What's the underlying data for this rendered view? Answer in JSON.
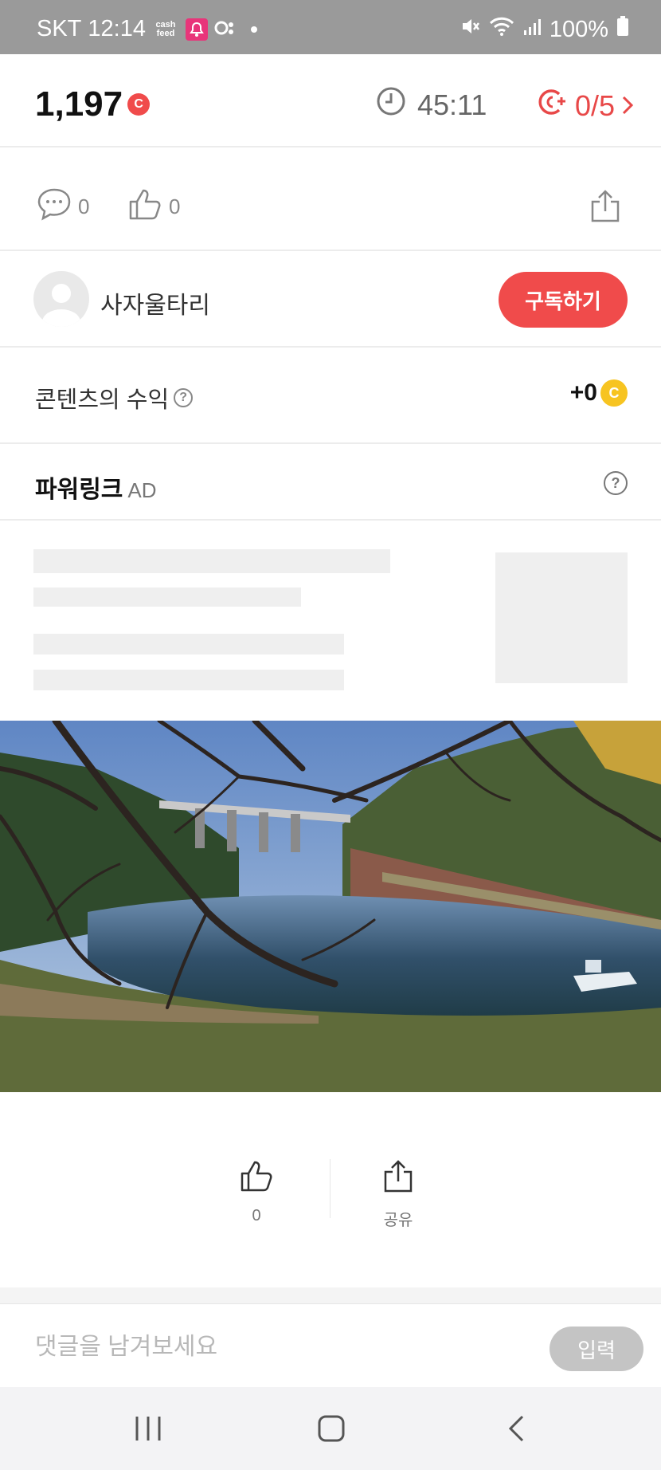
{
  "status_bar": {
    "carrier": "SKT",
    "time": "12:14",
    "cashfeed_line1": "cash",
    "cashfeed_line2": "feed",
    "battery": "100%"
  },
  "header": {
    "points": "1,197",
    "points_coin_letter": "C",
    "timer": "45:11",
    "quota": "0/5"
  },
  "actions": {
    "comment_count": "0",
    "like_count": "0"
  },
  "author": {
    "name": "사자울타리",
    "subscribe_label": "구독하기"
  },
  "earnings": {
    "label": "콘텐츠의 수익",
    "help": "?",
    "value": "+0",
    "coin_letter": "C"
  },
  "ad": {
    "title": "파워링크",
    "tag": "AD",
    "help": "?"
  },
  "photo": {
    "description_icon": "lake-landscape-photo"
  },
  "reactions": {
    "like_count": "0",
    "share_label": "공유"
  },
  "comment": {
    "placeholder": "댓글을 남겨보세요",
    "submit_label": "입력"
  },
  "colors": {
    "accent": "#f04b4b",
    "coin_yellow": "#f7c421",
    "status_bar": "#9a9a9a"
  }
}
